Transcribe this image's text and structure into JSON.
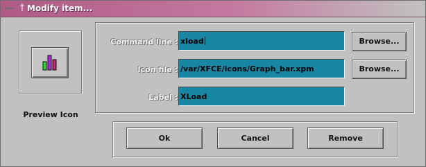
{
  "window": {
    "title": "Modify item...",
    "pin_glyph": "†"
  },
  "preview": {
    "label": "Preview Icon",
    "icon": "graph-bar-icon",
    "bar_colors": [
      "#2fd12f",
      "#b02ad4",
      "#c02070"
    ]
  },
  "form": {
    "command": {
      "label": "Command line :",
      "value": "xload"
    },
    "icon_file": {
      "label": "Icon file :",
      "value": "/var/XFCE/icons/Graph_bar.xpm"
    },
    "label": {
      "label": "Label :",
      "value": "XLoad"
    },
    "browse_label": "Browse...",
    "entry_color": "#1787a4"
  },
  "actions": {
    "ok": "Ok",
    "cancel": "Cancel",
    "remove": "Remove"
  }
}
